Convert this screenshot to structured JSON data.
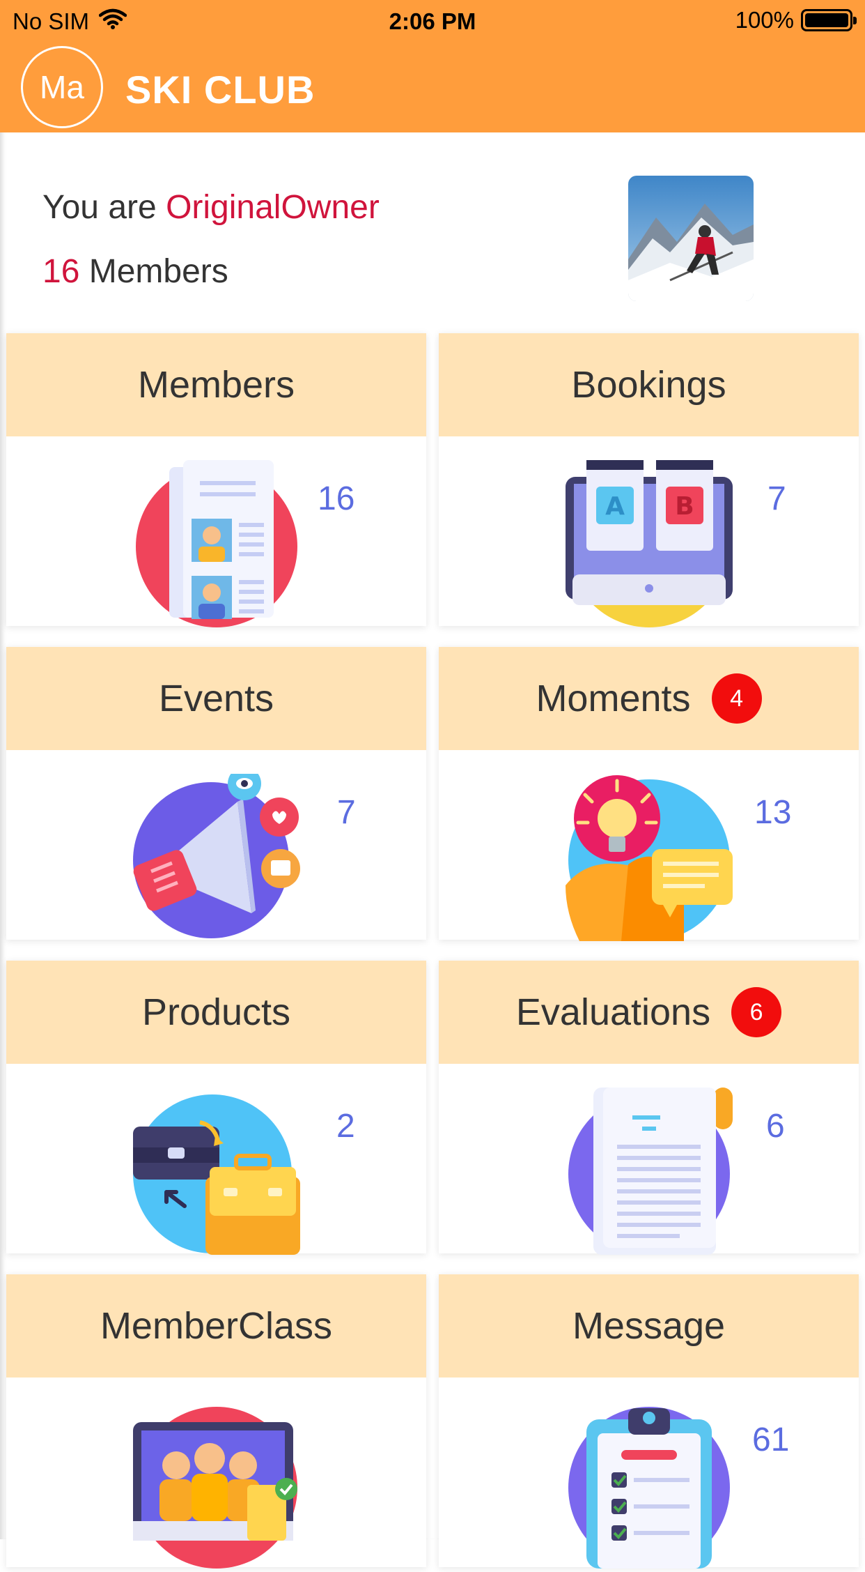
{
  "status_bar": {
    "carrier": "No SIM",
    "time": "2:06 PM",
    "battery": "100%"
  },
  "app_bar": {
    "avatar_initials": "Ma",
    "title": "SKI CLUB"
  },
  "summary": {
    "you_are_prefix": "You are",
    "role": "OriginalOwner",
    "member_count": "16",
    "members_suffix": "Members"
  },
  "tiles": [
    {
      "title": "Members",
      "count": "16",
      "badge": "",
      "icon": "members-cards-icon"
    },
    {
      "title": "Bookings",
      "count": "7",
      "badge": "",
      "icon": "bookings-ab-monitor-icon"
    },
    {
      "title": "Events",
      "count": "7",
      "badge": "",
      "icon": "megaphone-icon"
    },
    {
      "title": "Moments",
      "count": "13",
      "badge": "4",
      "icon": "lightbulb-idea-icon"
    },
    {
      "title": "Products",
      "count": "2",
      "badge": "",
      "icon": "briefcase-icon"
    },
    {
      "title": "Evaluations",
      "count": "6",
      "badge": "6",
      "icon": "document-scroll-icon"
    },
    {
      "title": "MemberClass",
      "count": "",
      "badge": "",
      "icon": "group-presentation-icon"
    },
    {
      "title": "Message",
      "count": "61",
      "badge": "",
      "icon": "clipboard-checklist-icon"
    }
  ],
  "colors": {
    "app_bar": "#FF9D3C",
    "tile_header": "#FFE3B6",
    "highlight_text": "#D0143C",
    "count_text": "#5B6CE0",
    "badge": "#F20D0D"
  }
}
